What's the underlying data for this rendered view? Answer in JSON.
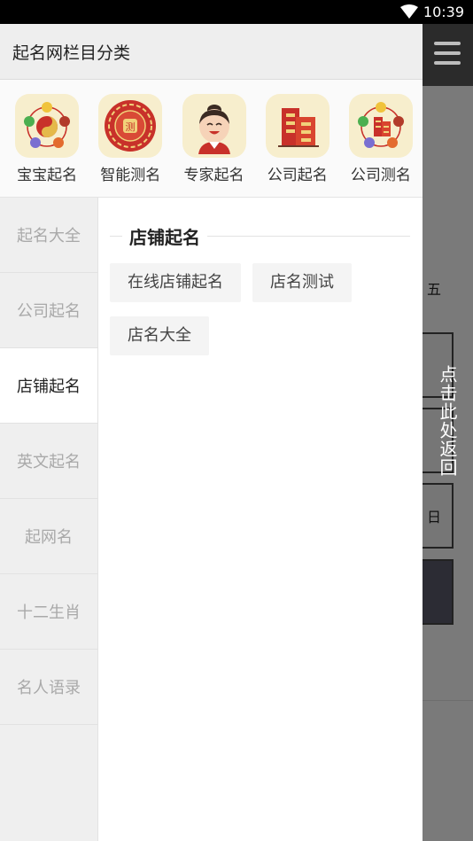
{
  "status_bar": {
    "time": "10:39"
  },
  "drawer": {
    "title": "起名网栏目分类",
    "quick_items": [
      {
        "label": "宝宝起名",
        "icon": "five-elements-yinyang-icon"
      },
      {
        "label": "智能测名",
        "icon": "bagua-ce-icon"
      },
      {
        "label": "专家起名",
        "icon": "expert-face-icon"
      },
      {
        "label": "公司起名",
        "icon": "building-icon"
      },
      {
        "label": "公司测名",
        "icon": "five-elements-building-icon"
      }
    ],
    "categories": [
      {
        "label": "起名大全"
      },
      {
        "label": "公司起名"
      },
      {
        "label": "店铺起名",
        "active": true
      },
      {
        "label": "英文起名"
      },
      {
        "label": "起网名"
      },
      {
        "label": "十二生肖"
      },
      {
        "label": "名人语录"
      }
    ],
    "section_title": "店铺起名",
    "tags": [
      "在线店铺起名",
      "店名测试",
      "店名大全"
    ]
  },
  "background": {
    "return_label": "点击此处返回",
    "box_chars": [
      "五",
      "日"
    ]
  },
  "colors": {
    "icon_bg": "#f7eecd",
    "accent_red": "#c8312a",
    "drawer_header": "#eeeeee"
  }
}
